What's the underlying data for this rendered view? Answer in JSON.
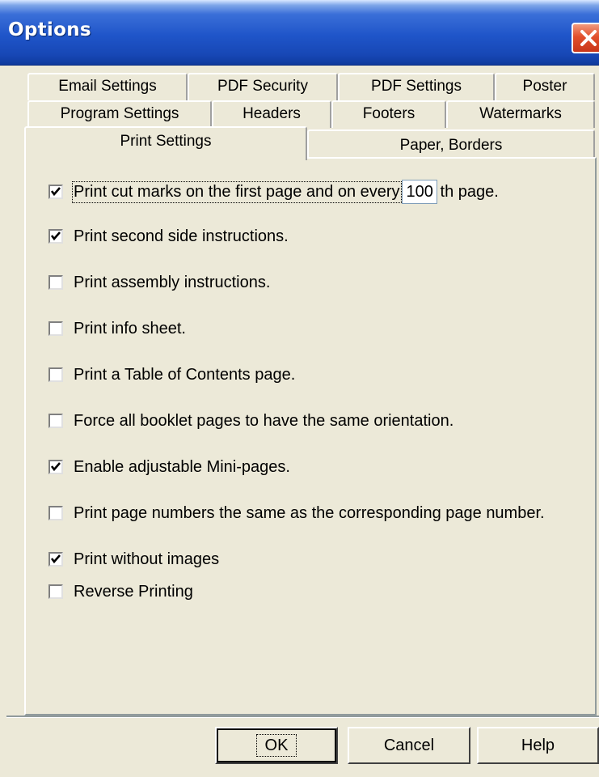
{
  "window": {
    "title": "Options"
  },
  "tabs": {
    "row1": [
      "Email Settings",
      "PDF Security",
      "PDF Settings",
      "Poster"
    ],
    "row2": [
      "Program Settings",
      "Headers",
      "Footers",
      "Watermarks"
    ],
    "row3": [
      "Print Settings",
      "Paper, Borders"
    ],
    "active": "Print Settings"
  },
  "options": [
    {
      "label_before": "Print cut marks on the first page and on every",
      "value": "100",
      "label_after": "th page.",
      "checked": true
    },
    {
      "label": "Print second side instructions.",
      "checked": true
    },
    {
      "label": "Print assembly instructions.",
      "checked": false
    },
    {
      "label": "Print info sheet.",
      "checked": false
    },
    {
      "label": "Print a Table of Contents page.",
      "checked": false
    },
    {
      "label": "Force all booklet pages to have the same orientation.",
      "checked": false
    },
    {
      "label": "Enable adjustable Mini-pages.",
      "checked": true
    },
    {
      "label": "Print page numbers the same as the corresponding page number.",
      "checked": false
    },
    {
      "label": "Print without images",
      "checked": true
    },
    {
      "label": "Reverse Printing",
      "checked": false
    }
  ],
  "buttons": {
    "ok": "OK",
    "cancel": "Cancel",
    "help": "Help"
  },
  "colors": {
    "titlebar": "#1f55c9",
    "dialog_bg": "#ece9d8",
    "close": "#e2502c"
  },
  "icons": {
    "close": "close-icon",
    "check": "check-icon"
  }
}
